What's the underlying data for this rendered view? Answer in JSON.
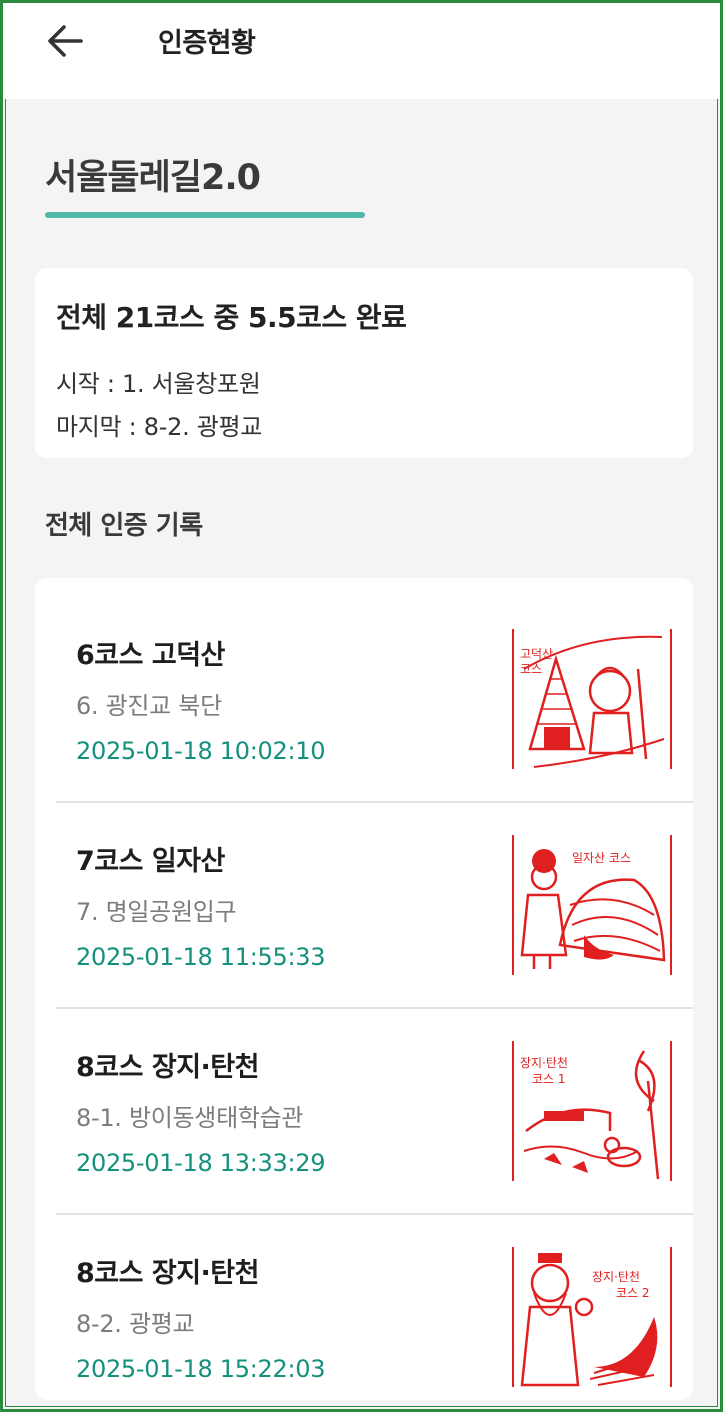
{
  "header": {
    "back_icon": "arrow-left-icon",
    "title": "인증현황"
  },
  "section": {
    "title": "서울둘레길2.0",
    "accent_color": "#4fb8a8"
  },
  "summary": {
    "headline": "전체 21코스 중 5.5코스 완료",
    "start": "시작 : 1. 서울창포원",
    "last": "마지막 : 8-2. 광평교"
  },
  "records": {
    "title": "전체 인증 기록",
    "time_color": "#14907c",
    "items": [
      {
        "course": "6코스 고덕산",
        "point": "6. 광진교 북단",
        "time": "2025-01-18 10:02:10",
        "stamp_icon": "godeoksan-stamp-icon",
        "stamp_text": [
          "고덕산",
          "코스"
        ]
      },
      {
        "course": "7코스 일자산",
        "point": "7. 명일공원입구",
        "time": "2025-01-18 11:55:33",
        "stamp_icon": "iljasan-stamp-icon",
        "stamp_text": [
          "일자산 코스"
        ]
      },
      {
        "course": "8코스 장지·탄천",
        "point": "8-1. 방이동생태학습관",
        "time": "2025-01-18 13:33:29",
        "stamp_icon": "jangji-tancheon-1-stamp-icon",
        "stamp_text": [
          "장지·탄천",
          "코스 1"
        ]
      },
      {
        "course": "8코스 장지·탄천",
        "point": "8-2. 광평교",
        "time": "2025-01-18 15:22:03",
        "stamp_icon": "jangji-tancheon-2-stamp-icon",
        "stamp_text": [
          "장지·탄천",
          "코스 2"
        ]
      }
    ]
  }
}
